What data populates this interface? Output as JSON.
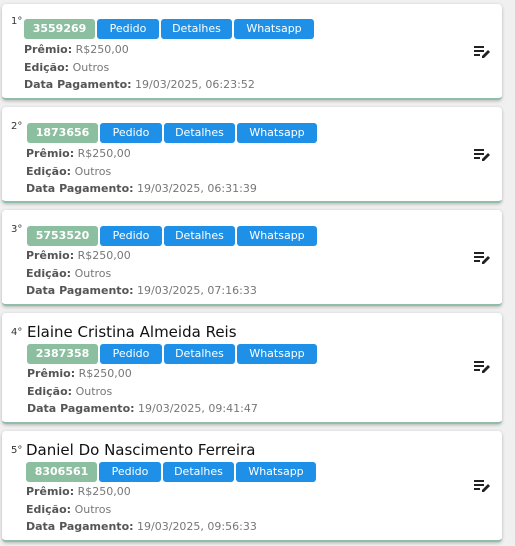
{
  "labels": {
    "premio": "Prêmio:",
    "edicao": "Edição:",
    "data_pagamento": "Data Pagamento:",
    "pedido": "Pedido",
    "detalhes": "Detalhes",
    "whatsapp": "Whatsapp"
  },
  "icons": {
    "edit": "playlist-edit-icon"
  },
  "colors": {
    "badge": "#8cbf9f",
    "button": "#1e90e8"
  },
  "winners": [
    {
      "rank": "1°",
      "name": "",
      "ticket": "3559269",
      "premio": "R$250,00",
      "edicao": "Outros",
      "data_pagamento": "19/03/2025, 06:23:52"
    },
    {
      "rank": "2°",
      "name": "",
      "ticket": "1873656",
      "premio": "R$250,00",
      "edicao": "Outros",
      "data_pagamento": "19/03/2025, 06:31:39"
    },
    {
      "rank": "3°",
      "name": "",
      "ticket": "5753520",
      "premio": "R$250,00",
      "edicao": "Outros",
      "data_pagamento": "19/03/2025, 07:16:33"
    },
    {
      "rank": "4°",
      "name": "Elaine Cristina Almeida Reis",
      "ticket": "2387358",
      "premio": "R$250,00",
      "edicao": "Outros",
      "data_pagamento": "19/03/2025, 09:41:47"
    },
    {
      "rank": "5°",
      "name": "Daniel Do Nascimento Ferreira",
      "ticket": "8306561",
      "premio": "R$250,00",
      "edicao": "Outros",
      "data_pagamento": "19/03/2025, 09:56:33"
    }
  ]
}
